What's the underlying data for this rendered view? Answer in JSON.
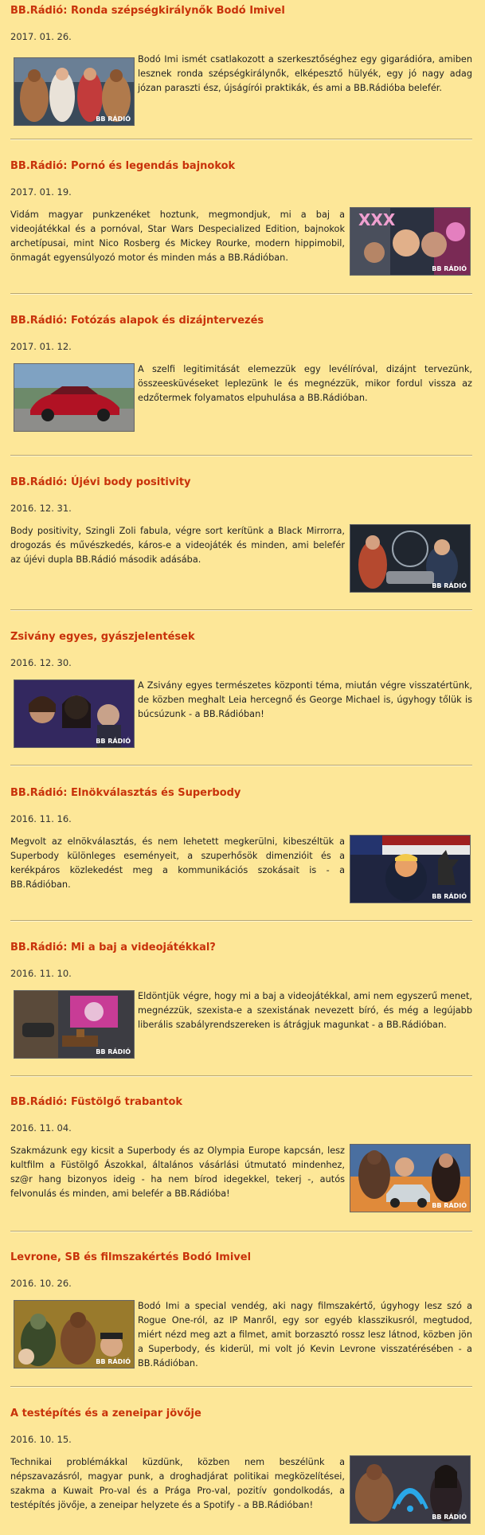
{
  "posts": [
    {
      "title": "BB.Rádió: Ronda szépségkirálynők Bodó Imivel",
      "date": "2017. 01. 26.",
      "body": "Bodó Imi ismét csatlakozott a szerkesztőséghez egy gigarádióra, amiben lesznek ronda szépségkirálynők, elképesztő hülyék, egy jó nagy adag józan paraszti ész, újságírói praktikák, és ami a BB.Rádióba belefér."
    },
    {
      "title": "BB.Rádió: Pornó és legendás bajnokok",
      "date": "2017. 01. 19.",
      "body": "Vidám magyar punkzenéket hoztunk, megmondjuk, mi a baj a videojátékkal és a pornóval, Star Wars Despecialized Edition, bajnokok archetípusai, mint Nico Rosberg és Mickey Rourke, modern hippimobil, önmagát egyensúlyozó motor és minden más a BB.Rádióban."
    },
    {
      "title": "BB.Rádió: Fotózás alapok és dizájntervezés",
      "date": "2017. 01. 12.",
      "body": "A szelfi legitimitását elemezzük egy levélíróval, dizájnt tervezünk, összeesküvéseket leplezünk le és megnézzük, mikor fordul vissza az edzőtermek folyamatos elpuhulása a BB.Rádióban."
    },
    {
      "title": "BB.Rádió: Újévi body positivity",
      "date": "2016. 12. 31.",
      "body": "Body positivity, Szingli Zoli fabula, végre sort kerítünk a Black Mirrorra, drogozás és művészkedés, káros-e a videojáték és minden, ami belefér az újévi dupla BB.Rádió második adásába."
    },
    {
      "title": "Zsivány egyes, gyászjelentések",
      "date": "2016. 12. 30.",
      "body": "A Zsivány egyes természetes központi téma, miután végre visszatértünk, de közben meghalt Leia hercegnő és George Michael is, úgyhogy tőlük is búcsúzunk - a BB.Rádióban!"
    },
    {
      "title": "BB.Rádió: Elnökválasztás és Superbody",
      "date": "2016. 11. 16.",
      "body": "Megvolt az elnökválasztás, és nem lehetett megkerülni, kibeszéltük a Superbody különleges eseményeit, a szuperhősök dimenzióit és a kerékpáros közlekedést meg a kommunikációs szokásait is - a BB.Rádióban."
    },
    {
      "title": "BB.Rádió: Mi a baj a videojátékkal?",
      "date": "2016. 11. 10.",
      "body": "Eldöntjük végre, hogy mi a baj a videojátékkal, ami nem egyszerű menet, megnézzük, szexista-e a szexistának nevezett bíró, és még a legújabb liberális szabályrendszereken is átrágjuk magunkat - a BB.Rádióban."
    },
    {
      "title": "BB.Rádió: Füstölgő trabantok",
      "date": "2016. 11. 04.",
      "body": "Szakmázunk egy kicsit a Superbody és az Olympia Europe kapcsán, lesz kultfilm a Füstölgő Ászokkal, általános vásárlási útmutató mindenhez, sz@r hang bizonyos ideig - ha nem bírod idegekkel, tekerj -, autós felvonulás és minden, ami belefér a BB.Rádióba!"
    },
    {
      "title": "Levrone, SB és filmszakértés Bodó Imivel",
      "date": "2016. 10. 26.",
      "body": "Bodó Imi a special vendég, aki nagy filmszakértő, úgyhogy lesz szó a Rogue One-ról, az IP Manről, egy sor egyéb klasszikusról, megtudod, miért nézd meg azt a filmet, amit borzasztó rossz lesz látnod, közben jön a Superbody, és kiderül, mi volt jó Kevin Levrone visszatérésében - a BB.Rádióban."
    },
    {
      "title": "A testépítés és a zeneipar jövője",
      "date": "2016. 10. 15.",
      "body": "Technikai problémákkal küzdünk, közben nem beszélünk a népszavazásról, magyar punk, a droghadjárat politikai megközelítései, szakma a Kuwait Pro-val és a Prága Pro-val, pozitív gondolkodás, a testépítés jövője, a zeneipar helyzete és a Spotify - a BB.Rádióban!"
    }
  ],
  "thumb_badge": "BB RÁDIÓ"
}
